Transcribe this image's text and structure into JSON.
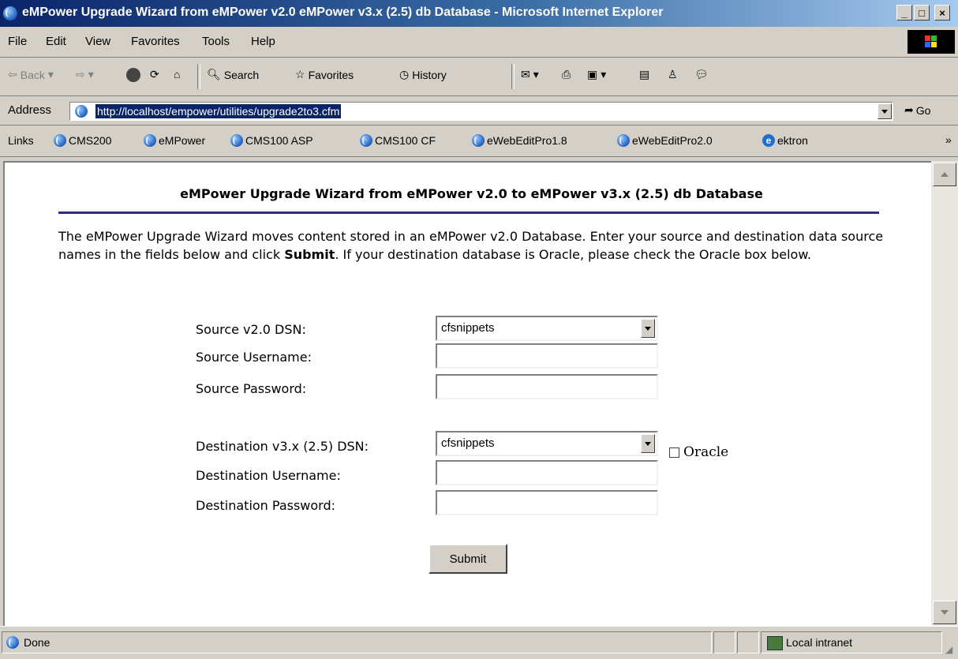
{
  "window": {
    "title": "eMPower Upgrade Wizard from eMPower v2.0 eMPower v3.x (2.5) db Database - Microsoft Internet Explorer",
    "buttons": {
      "minimize": "_",
      "maximize": "□",
      "close": "×"
    }
  },
  "menu": {
    "items": [
      {
        "name": "file",
        "label": "File"
      },
      {
        "name": "edit",
        "label": "Edit"
      },
      {
        "name": "view",
        "label": "View"
      },
      {
        "name": "favorites",
        "label": "Favorites"
      },
      {
        "name": "tools",
        "label": "Tools"
      },
      {
        "name": "help",
        "label": "Help"
      }
    ]
  },
  "toolbar": {
    "back_label": "Back",
    "search_label": "Search",
    "favorites_label": "Favorites",
    "history_label": "History",
    "icons": [
      "back-icon",
      "forward-icon",
      "stop-icon",
      "refresh-icon",
      "home-icon",
      "search-icon",
      "favorites-icon",
      "history-icon",
      "mail-icon",
      "print-icon",
      "edit-icon",
      "discuss-icon",
      "messenger-icon"
    ]
  },
  "address": {
    "label": "Address",
    "url": "http://localhost/empower/utilities/upgrade2to3.cfm",
    "go_label": "Go"
  },
  "links": {
    "label": "Links",
    "items": [
      "CMS200",
      "eMPower",
      "CMS100 ASP",
      "CMS100 CF",
      "eWebEditPro1.8",
      "eWebEditPro2.0",
      "ektron"
    ],
    "more": "»"
  },
  "page": {
    "heading": "eMPower Upgrade Wizard from eMPower v2.0 to eMPower v3.x (2.5) db Database",
    "intro_before": "The eMPower Upgrade Wizard moves content stored in an eMPower v2.0 Database. Enter your source and destination data source names in the fields below and click ",
    "intro_bold": "Submit",
    "intro_after": ". If your destination database is Oracle, please check the Oracle box below.",
    "form": {
      "source_dsn_label": "Source v2.0 DSN:",
      "source_dsn_value": "cfsnippets",
      "source_username_label": "Source Username:",
      "source_username_value": "",
      "source_password_label": "Source Password:",
      "source_password_value": "",
      "dest_dsn_label": "Destination v3.x (2.5) DSN:",
      "dest_dsn_value": "cfsnippets",
      "oracle_label": "Oracle",
      "oracle_checked": false,
      "dest_username_label": "Destination Username:",
      "dest_username_value": "",
      "dest_password_label": "Destination Password:",
      "dest_password_value": "",
      "submit_label": "Submit"
    }
  },
  "status": {
    "text": "Done",
    "zone": "Local intranet"
  },
  "colors": {
    "title_gradient_start": "#0a246a",
    "title_gradient_end": "#a6caf0",
    "chrome": "#d4d0c8",
    "heading_rule": "#2d2d7a",
    "selection": "#0a246a"
  }
}
